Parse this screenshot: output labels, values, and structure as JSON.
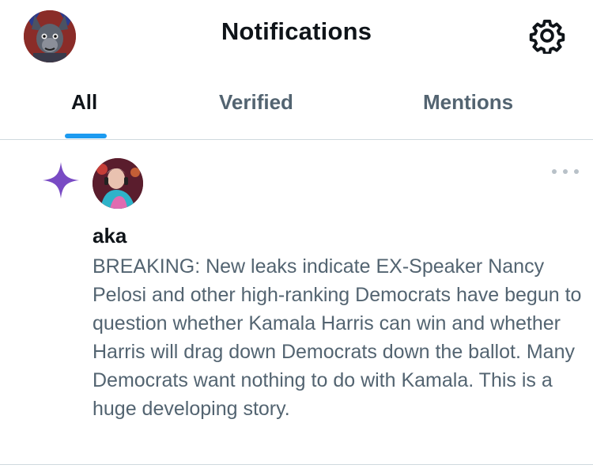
{
  "header": {
    "title": "Notifications",
    "avatar_icon": "user-avatar-icon",
    "settings_icon": "gear-icon"
  },
  "tabs": [
    {
      "label": "All",
      "active": true
    },
    {
      "label": "Verified",
      "active": false
    },
    {
      "label": "Mentions",
      "active": false
    }
  ],
  "colors": {
    "accent": "#1d9bf0",
    "sparkle": "#794bc4",
    "text_primary": "#0f1419",
    "text_secondary": "#536471"
  },
  "notification": {
    "type_icon": "sparkle-icon",
    "author": "aka",
    "text": "BREAKING: New leaks indicate EX-Speaker Nancy Pelosi and other high-ranking Democrats have begun to question whether Kamala Harris can win and whether Harris will drag down Democrats down the ballot. Many Democrats want nothing to do with Kamala. This is a huge developing story."
  }
}
